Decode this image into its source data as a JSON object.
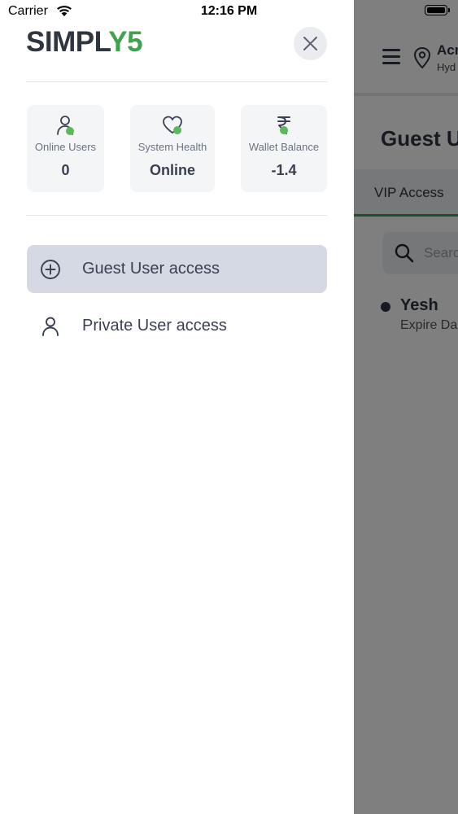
{
  "status_bar": {
    "carrier": "Carrier",
    "time": "12:16 PM"
  },
  "drawer": {
    "logo": {
      "main": "SIMPL",
      "accent": "Y5"
    },
    "stats": [
      {
        "icon": "user-icon",
        "label": "Online Users",
        "value": "0"
      },
      {
        "icon": "heart-icon",
        "label": "System Health",
        "value": "Online"
      },
      {
        "icon": "rupee-icon",
        "label": "Wallet Balance",
        "value": "-1.4"
      }
    ],
    "menu": [
      {
        "icon": "plus-circle-icon",
        "label": "Guest User access",
        "active": true
      },
      {
        "icon": "user-icon",
        "label": "Private User access",
        "active": false
      }
    ]
  },
  "background": {
    "header_title": "Acr",
    "header_subtitle": "Hyd",
    "page_title": "Guest Us",
    "tab": "VIP Access",
    "search_placeholder": "Searc",
    "item_name": "Yesh",
    "item_sub": "Expire Da"
  },
  "colors": {
    "accent": "#3fa34d",
    "active_menu_bg": "#d5d9e3",
    "overlay": "rgba(0,0,0,0.5)"
  }
}
